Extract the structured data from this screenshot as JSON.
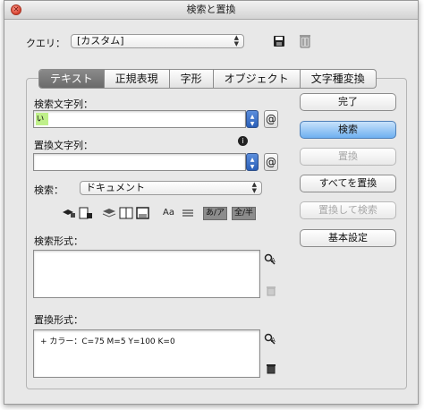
{
  "window": {
    "title": "検索と置換"
  },
  "query": {
    "label": "クエリ：",
    "selected": "[カスタム]"
  },
  "tabs": [
    {
      "label": "テキスト",
      "active": true
    },
    {
      "label": "正規表現",
      "active": false
    },
    {
      "label": "字形",
      "active": false
    },
    {
      "label": "オブジェクト",
      "active": false
    },
    {
      "label": "文字種変換",
      "active": false
    }
  ],
  "find": {
    "label": "検索文字列：",
    "value": "ぃ"
  },
  "change": {
    "label": "置換文字列：",
    "value": ""
  },
  "search_scope": {
    "label": "検索：",
    "selected": "ドキュメント"
  },
  "options": {
    "case_label": "Aa",
    "kana_label": "あ/ア",
    "width_label": "全/半"
  },
  "find_format": {
    "label": "検索形式：",
    "value": ""
  },
  "change_format": {
    "label": "置換形式：",
    "value": "+ カラー：C=75 M=5 Y=100 K=0"
  },
  "buttons": {
    "done": "完了",
    "find": "検索",
    "change": "置換",
    "change_all": "すべてを置換",
    "change_find": "置換して検索",
    "fewer_options": "基本設定"
  }
}
